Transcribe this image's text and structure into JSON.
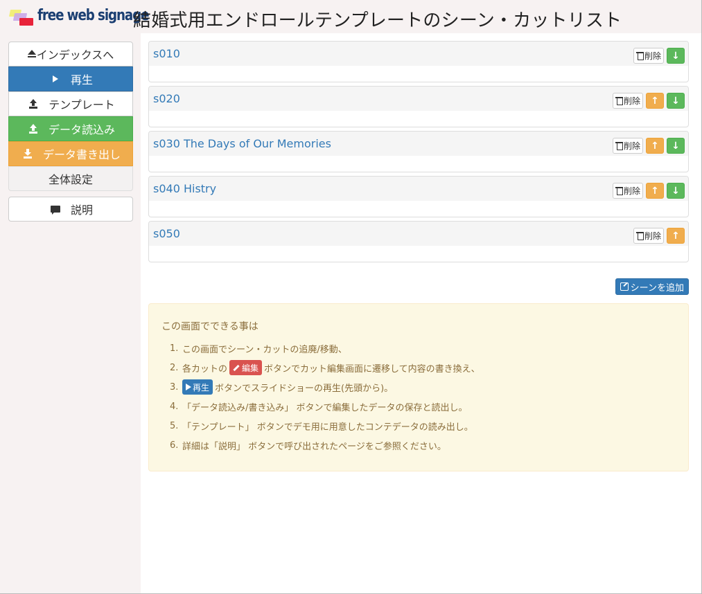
{
  "header": {
    "logo_text": "free web signage",
    "title": "結婚式用エンドロールテンプレートのシーン・カットリスト"
  },
  "sidebar": {
    "index_label": "インデックスへ",
    "play_label": "再生",
    "template_label": "テンプレート",
    "data_load_label": "データ読込み",
    "data_export_label": "データ書き出し",
    "settings_label": "全体設定",
    "help_label": "説明"
  },
  "scenes": [
    {
      "title": "s010",
      "delete_label": "削除",
      "up": false,
      "down": true
    },
    {
      "title": "s020",
      "delete_label": "削除",
      "up": true,
      "down": true
    },
    {
      "title": "s030 The Days of Our Memories",
      "delete_label": "削除",
      "up": true,
      "down": true
    },
    {
      "title": "s040 Histry",
      "delete_label": "削除",
      "up": true,
      "down": true
    },
    {
      "title": "s050",
      "delete_label": "削除",
      "up": true,
      "down": false
    }
  ],
  "add_scene_label": "シーンを追加",
  "info": {
    "heading": "この画面でできる事は",
    "items": [
      {
        "num": "1.",
        "text": "この画面でシーン・カットの追廃/移動、"
      },
      {
        "num": "2.",
        "pre": "各カットの",
        "badge": "編集",
        "text": "ボタンでカット編集画面に遷移して内容の書き換え、"
      },
      {
        "num": "3.",
        "badge": "再生",
        "text": "ボタンでスライドショーの再生(先頭から)。"
      },
      {
        "num": "4.",
        "text": "「データ読込み/書き込み」 ボタンで編集したデータの保存と読出し。"
      },
      {
        "num": "5.",
        "text": "「テンプレート」 ボタンでデモ用に用意したコンテデータの読み出し。"
      },
      {
        "num": "6.",
        "text": "詳細は「説明」 ボタンで呼び出されたページをご参照ください。"
      }
    ]
  },
  "colors": {
    "primary": "#337ab7",
    "success": "#5cb85c",
    "warning": "#f0ad4e",
    "danger": "#d9534f"
  }
}
